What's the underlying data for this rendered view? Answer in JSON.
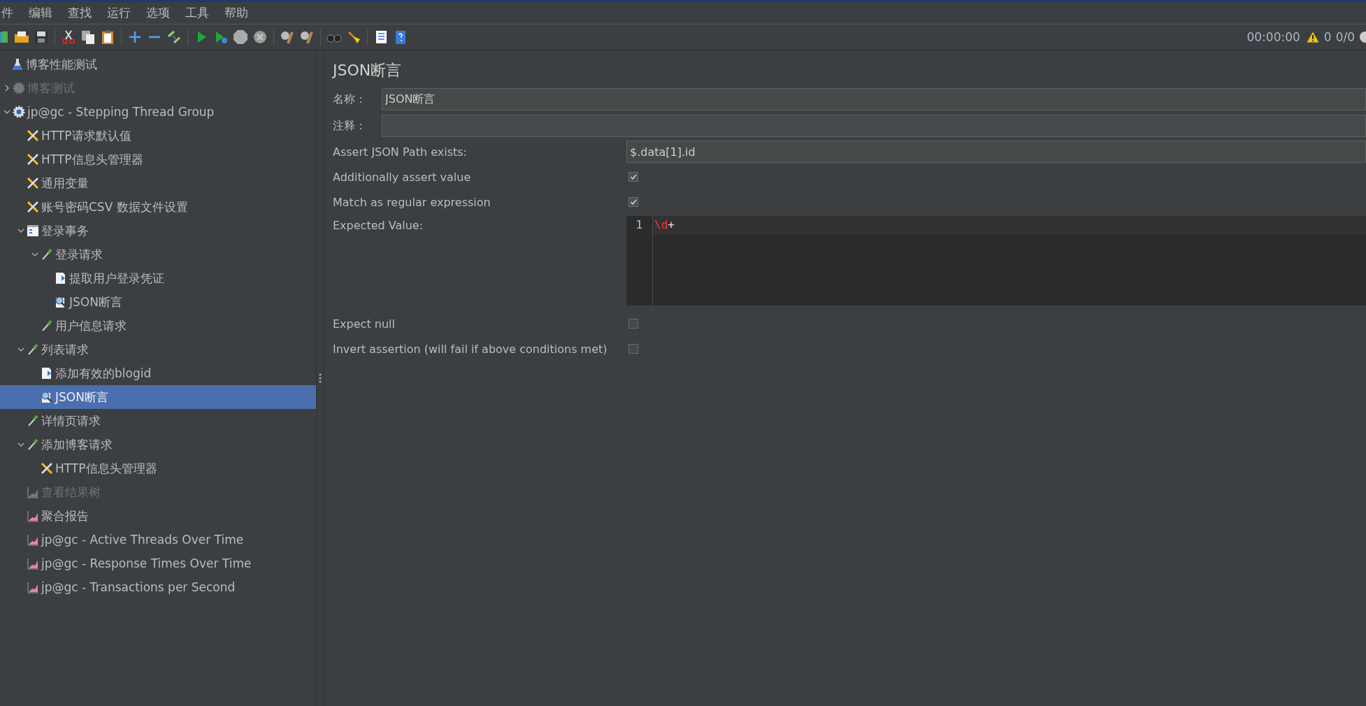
{
  "menu": [
    "件",
    "编辑",
    "查找",
    "运行",
    "选项",
    "工具",
    "帮助"
  ],
  "status": {
    "timer": "00:00:00",
    "warnings": "0",
    "threads": "0/0"
  },
  "tree": [
    {
      "label": "博客性能测试",
      "kind": "testplan",
      "disabled": false,
      "selected": false,
      "children": [
        {
          "label": "博客测试",
          "kind": "threadgroup",
          "disabled": true,
          "selected": false,
          "expanded": false
        },
        {
          "label": "jp@gc - Stepping Thread Group",
          "kind": "threadgroup",
          "disabled": false,
          "selected": false,
          "expanded": true,
          "children": [
            {
              "label": "HTTP请求默认值",
              "kind": "config",
              "disabled": false,
              "selected": false
            },
            {
              "label": "HTTP信息头管理器",
              "kind": "config",
              "disabled": false,
              "selected": false
            },
            {
              "label": "通用变量",
              "kind": "config",
              "disabled": false,
              "selected": false
            },
            {
              "label": "账号密码CSV 数据文件设置",
              "kind": "config",
              "disabled": false,
              "selected": false
            },
            {
              "label": "登录事务",
              "kind": "transaction",
              "disabled": false,
              "selected": false,
              "expanded": true,
              "children": [
                {
                  "label": "登录请求",
                  "kind": "sampler",
                  "disabled": false,
                  "selected": false,
                  "expanded": true,
                  "children": [
                    {
                      "label": "提取用户登录凭证",
                      "kind": "postprocessor",
                      "disabled": false,
                      "selected": false
                    },
                    {
                      "label": "JSON断言",
                      "kind": "assertion",
                      "disabled": false,
                      "selected": false
                    }
                  ]
                },
                {
                  "label": "用户信息请求",
                  "kind": "sampler",
                  "disabled": false,
                  "selected": false
                }
              ]
            },
            {
              "label": "列表请求",
              "kind": "sampler",
              "disabled": false,
              "selected": false,
              "expanded": true,
              "children": [
                {
                  "label": "添加有效的blogid",
                  "kind": "postprocessor",
                  "disabled": false,
                  "selected": false
                },
                {
                  "label": "JSON断言",
                  "kind": "assertion",
                  "disabled": false,
                  "selected": true
                }
              ]
            },
            {
              "label": "详情页请求",
              "kind": "sampler",
              "disabled": false,
              "selected": false
            },
            {
              "label": "添加博客请求",
              "kind": "sampler",
              "disabled": false,
              "selected": false,
              "expanded": true,
              "children": [
                {
                  "label": "HTTP信息头管理器",
                  "kind": "config",
                  "disabled": false,
                  "selected": false
                }
              ]
            },
            {
              "label": "查看结果树",
              "kind": "listener",
              "disabled": true,
              "selected": false
            },
            {
              "label": "聚合报告",
              "kind": "listener",
              "disabled": false,
              "selected": false
            },
            {
              "label": "jp@gc - Active Threads Over Time",
              "kind": "listener",
              "disabled": false,
              "selected": false
            },
            {
              "label": "jp@gc - Response Times Over Time",
              "kind": "listener",
              "disabled": false,
              "selected": false
            },
            {
              "label": "jp@gc - Transactions per Second",
              "kind": "listener",
              "disabled": false,
              "selected": false
            }
          ]
        }
      ]
    }
  ],
  "panel": {
    "title": "JSON断言",
    "name": {
      "label": "名称：",
      "value": "JSON断言"
    },
    "comment": {
      "label": "注释："
    },
    "json_path": {
      "label": "Assert JSON Path exists:",
      "value": "$.data[1].id"
    },
    "options_top": [
      {
        "label": "Additionally assert value",
        "checked": true
      },
      {
        "label": "Match as regular expression",
        "checked": true
      }
    ],
    "expected": {
      "label": "Expected Value:",
      "lines": [
        {
          "number": "1",
          "tokens": [
            {
              "text": "\\d",
              "kind": "regex"
            },
            {
              "text": "+",
              "kind": "plain"
            }
          ]
        }
      ]
    },
    "options_bottom": [
      {
        "label": "Expect null",
        "checked": false
      },
      {
        "label": "Invert assertion (will fail if above conditions met)",
        "checked": false
      }
    ]
  }
}
